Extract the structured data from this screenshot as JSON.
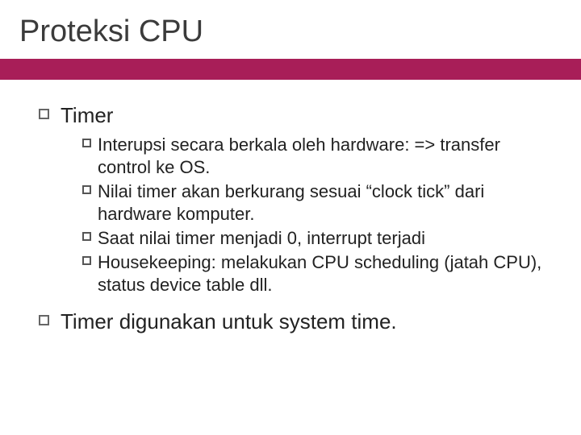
{
  "title": "Proteksi CPU",
  "items": [
    {
      "label": "Timer",
      "sub": [
        "Interupsi secara berkala oleh hardware: => transfer control ke OS.",
        "Nilai timer akan berkurang sesuai “clock tick” dari hardware komputer.",
        "Saat nilai timer menjadi 0, interrupt terjadi",
        "Housekeeping: melakukan CPU scheduling (jatah CPU), status device table dll."
      ]
    },
    {
      "label": "Timer digunakan untuk system time.",
      "sub": []
    }
  ]
}
